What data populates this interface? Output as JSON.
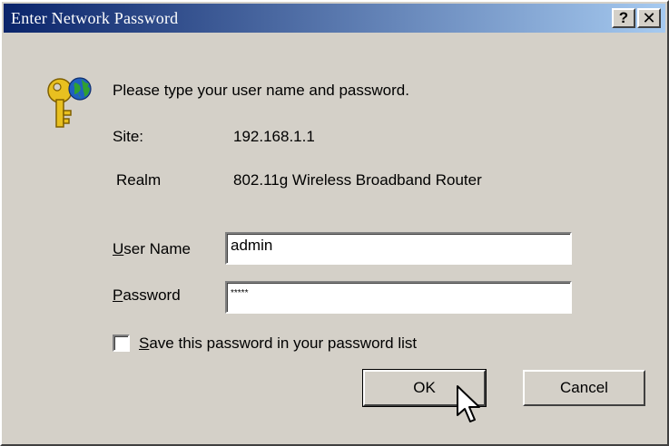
{
  "window": {
    "title": "Enter Network Password",
    "help_label": "?",
    "close_label": "✕"
  },
  "dialog": {
    "prompt": "Please type your user name and password.",
    "site_label": "Site:",
    "site_value": "192.168.1.1",
    "realm_label": "Realm",
    "realm_value": "802.11g Wireless Broadband Router",
    "username_label_key": "U",
    "username_label_rest": "ser Name",
    "username_value": "admin",
    "password_label_key": "P",
    "password_label_rest": "assword",
    "password_value": "*****",
    "save_label_key": "S",
    "save_label_rest": "ave this password in your password list",
    "ok_label": "OK",
    "cancel_label": "Cancel"
  },
  "icons": {
    "dialog_icon": "key-globe-icon",
    "pointer": "mouse-pointer-icon"
  },
  "colors": {
    "titlebar_start": "#0a246a",
    "titlebar_end": "#a6caf0",
    "face": "#d4d0c8"
  }
}
